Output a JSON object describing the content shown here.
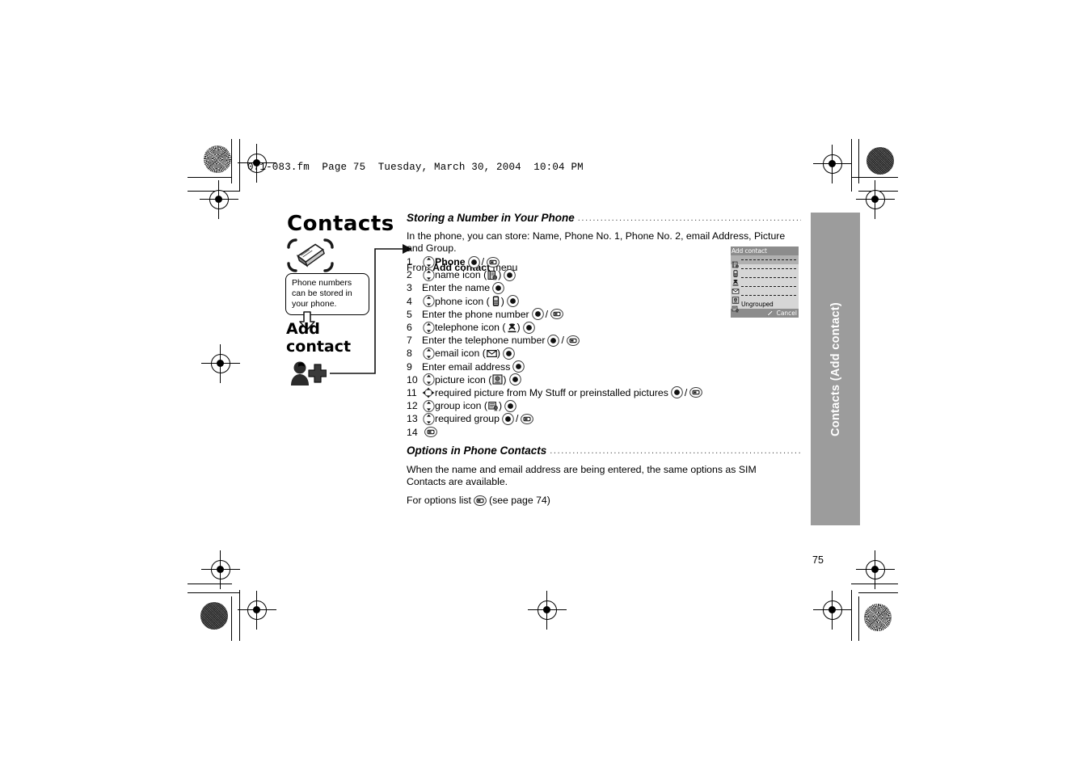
{
  "header": {
    "file_line": "071-083.fm  Page 75  Tuesday, March 30, 2004  10:04 PM"
  },
  "left_column": {
    "chapter_title": "Contacts",
    "chapter_icon": "contacts-card-icon",
    "callout_text": "Phone numbers can be stored in your phone.",
    "down_arrow_icon": "down-arrow-icon",
    "sub_title": "Add contact",
    "add_contact_icon": "add-person-icon"
  },
  "sections": [
    {
      "heading": "Storing a Number in Your Phone",
      "intro": "In the phone, you can store: Name, Phone No. 1, Phone No. 2, email Address, Picture and Group.",
      "from_prefix": "From ",
      "from_bold": "Add contact",
      "from_suffix": " menu"
    },
    {
      "heading": "Options in Phone Contacts",
      "paragraph": "When the name and email address are being entered, the same options as SIM Contacts are available.",
      "options_prefix": "For options list ",
      "options_suffix": " (see page 74)"
    }
  ],
  "steps": [
    {
      "num": "1",
      "parts": [
        {
          "t": "nav"
        },
        {
          "t": "text",
          "v": "Phone",
          "bold": true
        },
        {
          "t": "sel"
        },
        {
          "t": "slash"
        },
        {
          "t": "soft"
        }
      ]
    },
    {
      "num": "2",
      "parts": [
        {
          "t": "nav"
        },
        {
          "t": "text",
          "v": "name icon ("
        },
        {
          "t": "glyph",
          "v": "name-book-icon"
        },
        {
          "t": "text",
          "v": ")"
        },
        {
          "t": "sel"
        }
      ]
    },
    {
      "num": "3",
      "parts": [
        {
          "t": "text",
          "v": "Enter the name"
        },
        {
          "t": "sel"
        }
      ]
    },
    {
      "num": "4",
      "parts": [
        {
          "t": "nav"
        },
        {
          "t": "text",
          "v": "phone icon ("
        },
        {
          "t": "glyph",
          "v": "mobile-phone-icon"
        },
        {
          "t": "text",
          "v": ")"
        },
        {
          "t": "sel"
        }
      ]
    },
    {
      "num": "5",
      "parts": [
        {
          "t": "text",
          "v": "Enter the phone number"
        },
        {
          "t": "sel"
        },
        {
          "t": "slash"
        },
        {
          "t": "soft"
        }
      ]
    },
    {
      "num": "6",
      "parts": [
        {
          "t": "nav"
        },
        {
          "t": "text",
          "v": "telephone icon ("
        },
        {
          "t": "glyph",
          "v": "telephone-icon"
        },
        {
          "t": "text",
          "v": ")"
        },
        {
          "t": "sel"
        }
      ]
    },
    {
      "num": "7",
      "parts": [
        {
          "t": "text",
          "v": "Enter the telephone number"
        },
        {
          "t": "sel"
        },
        {
          "t": "slash"
        },
        {
          "t": "soft"
        }
      ]
    },
    {
      "num": "8",
      "parts": [
        {
          "t": "nav"
        },
        {
          "t": "text",
          "v": "email icon ("
        },
        {
          "t": "glyph",
          "v": "envelope-icon"
        },
        {
          "t": "text",
          "v": ")"
        },
        {
          "t": "sel"
        }
      ]
    },
    {
      "num": "9",
      "parts": [
        {
          "t": "text",
          "v": "Enter email address"
        },
        {
          "t": "sel"
        }
      ]
    },
    {
      "num": "10",
      "parts": [
        {
          "t": "nav"
        },
        {
          "t": "text",
          "v": "picture icon ("
        },
        {
          "t": "glyph",
          "v": "picture-icon"
        },
        {
          "t": "text",
          "v": ")"
        },
        {
          "t": "sel"
        }
      ]
    },
    {
      "num": "11",
      "parts": [
        {
          "t": "nav4"
        },
        {
          "t": "text",
          "v": "required picture from My Stuff or preinstalled pictures"
        },
        {
          "t": "sel"
        },
        {
          "t": "slash"
        },
        {
          "t": "soft"
        }
      ]
    },
    {
      "num": "12",
      "parts": [
        {
          "t": "nav"
        },
        {
          "t": "text",
          "v": "group icon ("
        },
        {
          "t": "glyph",
          "v": "group-icon"
        },
        {
          "t": "text",
          "v": ")"
        },
        {
          "t": "sel"
        }
      ]
    },
    {
      "num": "13",
      "parts": [
        {
          "t": "nav"
        },
        {
          "t": "text",
          "v": "required group"
        },
        {
          "t": "sel"
        },
        {
          "t": "slash"
        },
        {
          "t": "soft"
        }
      ]
    },
    {
      "num": "14",
      "parts": [
        {
          "t": "soft"
        }
      ]
    }
  ],
  "phone_screen": {
    "title": "Add contact",
    "rows": [
      {
        "icon": "name-book-icon",
        "value": "",
        "selected": true
      },
      {
        "icon": "mobile-phone-icon",
        "value": "",
        "selected": false
      },
      {
        "icon": "telephone-icon",
        "value": "",
        "selected": false
      },
      {
        "icon": "envelope-icon",
        "value": "",
        "selected": false
      },
      {
        "icon": "picture-icon",
        "value": "",
        "selected": false
      },
      {
        "icon": "group-icon",
        "value": "Ungrouped",
        "selected": false
      }
    ],
    "softkey_icon": "pencil-icon",
    "softkey_label": "Cancel"
  },
  "side_tab": {
    "label": "Contacts  (Add contact)",
    "color": "#9c9c9c"
  },
  "page_number": "75"
}
